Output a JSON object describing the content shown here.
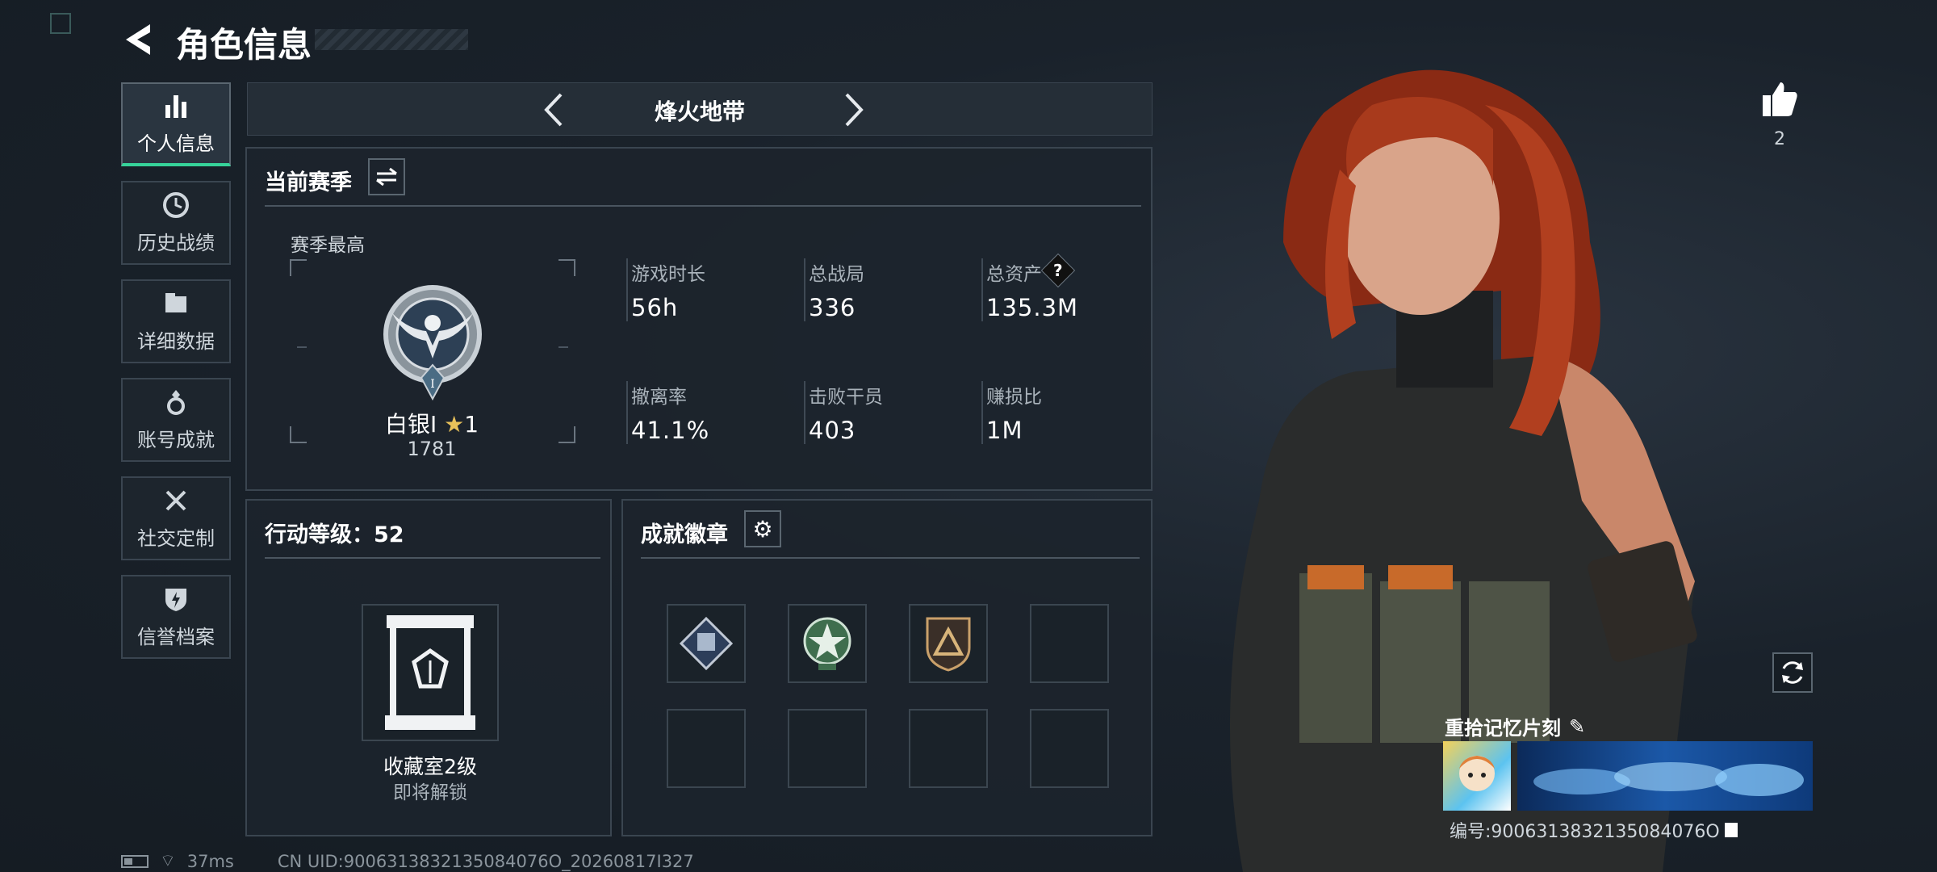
{
  "header": {
    "title": "角色信息"
  },
  "nav": {
    "items": [
      {
        "label": "个人信息",
        "icon": "bar-chart-icon",
        "active": true
      },
      {
        "label": "历史战绩",
        "icon": "clock-icon"
      },
      {
        "label": "详细数据",
        "icon": "folder-icon"
      },
      {
        "label": "账号成就",
        "icon": "medal-icon"
      },
      {
        "label": "社交定制",
        "icon": "tools-icon"
      },
      {
        "label": "信誉档案",
        "icon": "shield-bolt-icon"
      }
    ]
  },
  "mode_selector": {
    "label": "烽火地带"
  },
  "season": {
    "title": "当前赛季",
    "best_label": "赛季最高",
    "rank_name": "白银I",
    "rank_stars": "1",
    "rank_score": "1781",
    "stats": [
      {
        "label": "游戏时长",
        "value": "56h"
      },
      {
        "label": "总战局",
        "value": "336"
      },
      {
        "label": "总资产",
        "value": "135.3M"
      },
      {
        "label": "撤离率",
        "value": "41.1%"
      },
      {
        "label": "击败干员",
        "value": "403"
      },
      {
        "label": "赚损比",
        "value": "1M"
      }
    ]
  },
  "level": {
    "title": "行动等级：52",
    "collection_name": "收藏室2级",
    "collection_status": "即将解锁"
  },
  "badges": {
    "title": "成就徽章"
  },
  "likes": {
    "count": "2"
  },
  "memory": {
    "title": "重拾记忆片刻",
    "id_text": "编号:9006313832135084076O"
  },
  "status": {
    "ping": "37ms",
    "uid": "CN UID:9006313832135084076O_20260817I327"
  },
  "colors": {
    "accent": "#36d39a",
    "panel_border": "#3a4550",
    "background": "#1a222b"
  }
}
